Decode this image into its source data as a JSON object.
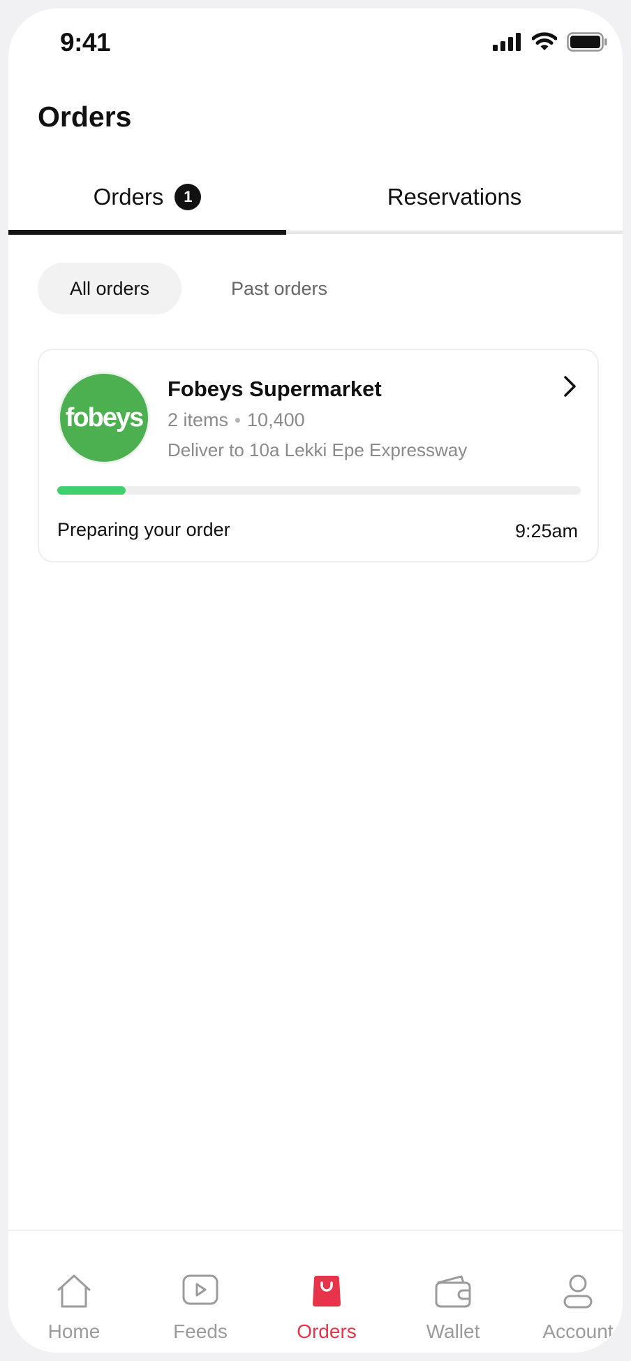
{
  "status_bar": {
    "time": "9:41"
  },
  "page": {
    "title": "Orders"
  },
  "tabs": [
    {
      "label": "Orders",
      "badge": "1",
      "active": true
    },
    {
      "label": "Reservations",
      "active": false
    }
  ],
  "filters": [
    {
      "label": "All orders",
      "selected": true
    },
    {
      "label": "Past orders",
      "selected": false
    }
  ],
  "order": {
    "logo_text": "fobeys",
    "store_name": "Fobeys Supermarket",
    "items": "2 items",
    "price": "10,400",
    "delivery": "Deliver to 10a Lekki Epe Expressway",
    "progress": 0.13,
    "status": "Preparing your order",
    "time": "9:25am"
  },
  "bottom_nav": [
    {
      "label": "Home",
      "icon": "home-icon",
      "active": false
    },
    {
      "label": "Feeds",
      "icon": "play-icon",
      "active": false
    },
    {
      "label": "Orders",
      "icon": "shopping-bag-icon",
      "active": true
    },
    {
      "label": "Wallet",
      "icon": "wallet-icon",
      "active": false
    },
    {
      "label": "Account",
      "icon": "user-icon",
      "active": false
    }
  ],
  "colors": {
    "accent": "#e8344a",
    "progress": "#3fcf6f",
    "logo_bg": "#4caf50",
    "text": "#111111",
    "muted": "#8a8a8a"
  }
}
